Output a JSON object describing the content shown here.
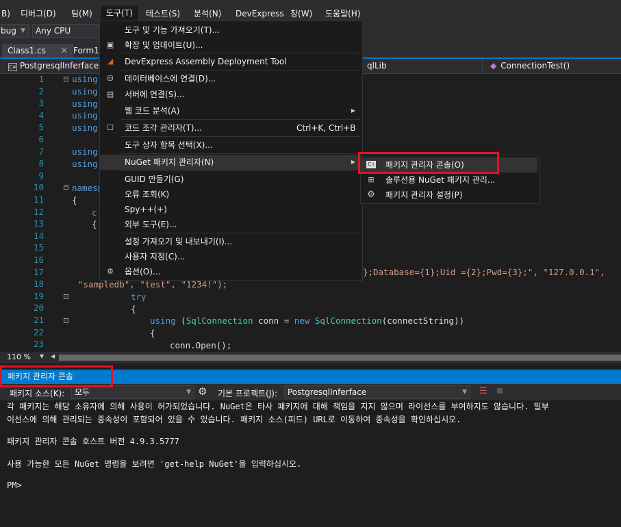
{
  "menubar": {
    "items": [
      "B)",
      "디버그(D)",
      "팀(M)",
      "도구(T)",
      "테스트(S)",
      "분석(N)",
      "DevExpress",
      "창(W)",
      "도움말(H)"
    ]
  },
  "toolbar": {
    "config": "bug",
    "platform": "Any CPU"
  },
  "tabs": [
    "Class1.cs",
    "Form1."
  ],
  "navbar": {
    "project": "PostgresqlInferface",
    "lib": "qlLib",
    "member": "ConnectionTest()"
  },
  "editor": {
    "line_numbers": [
      "1",
      "2",
      "3",
      "4",
      "5",
      "6",
      "7",
      "8",
      "9",
      "10",
      "11",
      "12",
      "13",
      "14",
      "15",
      "16",
      "17",
      "18",
      "19",
      "20",
      "21",
      "22",
      "23"
    ],
    "line17_tail": "};Database={1};Uid ={2};Pwd={3};\", \"127.0.0.1\",",
    "line18": "\"sampledb\", \"test\", \"1234!\");",
    "line19": "try",
    "line20": "{",
    "line21_kw1": "using",
    "line21_p1": " (",
    "line21_type": "SqlConnection",
    "line21_p2": " conn = ",
    "line21_kw2": "new",
    "line21_type2": "SqlConnection",
    "line21_p3": "(connectString))",
    "line22": "{",
    "line23": "conn.Open();",
    "frag_using": "using",
    "frag_namesp": "namesp",
    "frag_brace": "{",
    "frag_c": "c",
    "frag_brace2": "{"
  },
  "zoom": "110 %",
  "tools_menu": {
    "items": [
      {
        "label": "도구 및 기능 가져오기(T)...",
        "shortcut": "",
        "icon": ""
      },
      {
        "label": "확장 및 업데이트(U)...",
        "shortcut": "",
        "icon": "extensions-icon"
      },
      {
        "label": "DevExpress Assembly Deployment Tool",
        "shortcut": "",
        "icon": "devexpress-icon"
      },
      {
        "label": "데이터베이스에 연결(D)...",
        "shortcut": "",
        "icon": "database-connect-icon"
      },
      {
        "label": "서버에 연결(S)...",
        "shortcut": "",
        "icon": "server-connect-icon"
      },
      {
        "label": "웹 코드 분석(A)",
        "shortcut": "",
        "icon": ""
      },
      {
        "label": "코드 조각 관리자(T)...",
        "shortcut": "Ctrl+K, Ctrl+B",
        "icon": "snippet-icon"
      },
      {
        "label": "도구 상자 항목 선택(X)...",
        "shortcut": "",
        "icon": ""
      },
      {
        "label": "NuGet 패키지 관리자(N)",
        "shortcut": "",
        "icon": ""
      },
      {
        "label": "GUID 만들기(G)",
        "shortcut": "",
        "icon": ""
      },
      {
        "label": "오류 조회(K)",
        "shortcut": "",
        "icon": ""
      },
      {
        "label": "Spy++(+)",
        "shortcut": "",
        "icon": ""
      },
      {
        "label": "외부 도구(E)...",
        "shortcut": "",
        "icon": ""
      },
      {
        "label": "설정 가져오기 및 내보내기(I)...",
        "shortcut": "",
        "icon": ""
      },
      {
        "label": "사용자 지정(C)...",
        "shortcut": "",
        "icon": ""
      },
      {
        "label": "옵션(O)...",
        "shortcut": "",
        "icon": "gear-icon"
      }
    ]
  },
  "nuget_submenu": {
    "items": [
      {
        "label": "패키지 관리자 콘솔(O)",
        "icon": "console-icon"
      },
      {
        "label": "솔루션용 NuGet 패키지 관리...",
        "icon": "package-icon"
      },
      {
        "label": "패키지 관리자 설정(P)",
        "icon": "gear-icon"
      }
    ]
  },
  "console": {
    "title": "패키지 관리자 콘솔",
    "source_label": "패키지 소스(K):",
    "source_value": "모두",
    "project_label": "기본 프로젝트(J):",
    "project_value": "PostgresqlInferface",
    "lines": [
      "각 패키지는 해당 소유자에 의해 사용이 허가되었습니다. NuGet은 타사 패키지에 대해 책임을 지지 않으며 라이선스를 부여하지도 않습니다. 일부",
      "이선스에 의해 관리되는 종속성이 포함되어 있을 수 있습니다. 패키지 소스(피드) URL로 이동하여 종속성을 확인하십시오.",
      "",
      "패키지 관리자 콘솔 호스트 버전 4.9.3.5777",
      "",
      "사용 가능한 모든 NuGet 명령을 보려면 'get-help NuGet'을 입력하십시오.",
      "",
      "PM>"
    ]
  },
  "colors": {
    "accent": "#007acc",
    "highlight_red": "#e81123",
    "background": "#1e1e1e"
  }
}
